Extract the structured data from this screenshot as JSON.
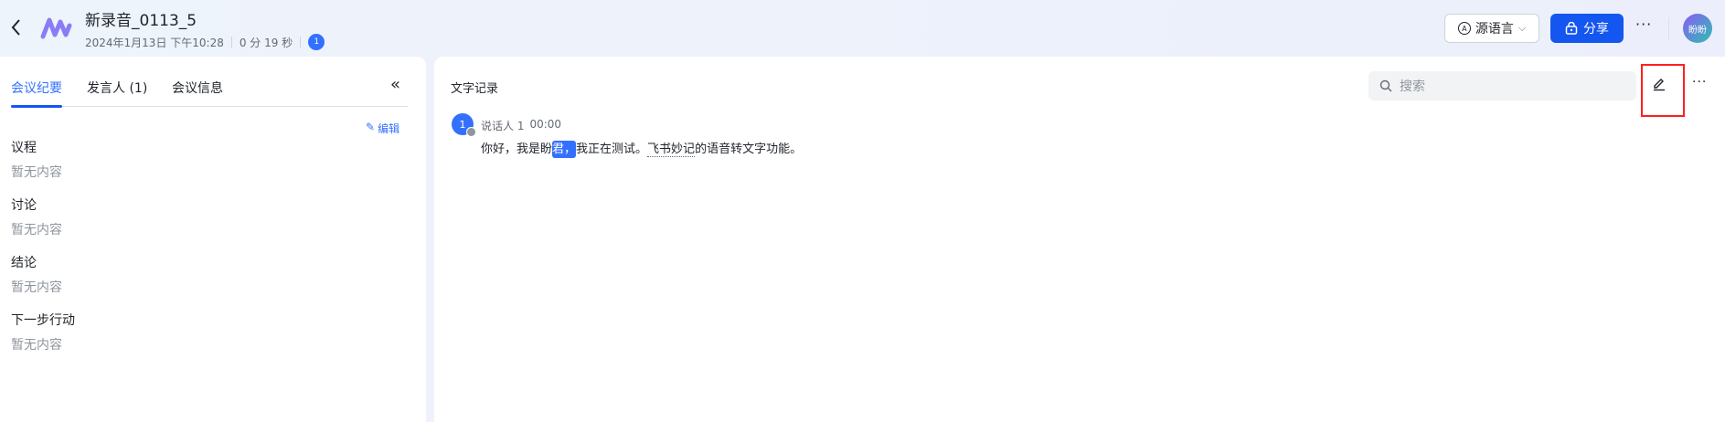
{
  "header": {
    "title": "新录音_0113_5",
    "date": "2024年1月13日 下午10:28",
    "duration": "0 分 19 秒",
    "participant_count": "1",
    "lang_button": "源语言",
    "share_button": "分享",
    "more": "···",
    "user_avatar": "盼盼"
  },
  "left": {
    "tabs": [
      "会议纪要",
      "发言人 (1)",
      "会议信息"
    ],
    "collapse": "«",
    "edit": "编辑",
    "sections": [
      {
        "title": "议程",
        "content": "暂无内容"
      },
      {
        "title": "讨论",
        "content": "暂无内容"
      },
      {
        "title": "结论",
        "content": "暂无内容"
      },
      {
        "title": "下一步行动",
        "content": "暂无内容"
      }
    ]
  },
  "right": {
    "title": "文字记录",
    "search_placeholder": "搜索",
    "more": "···",
    "transcript": [
      {
        "avatar": "1",
        "speaker": "说话人 1",
        "time": "00:00",
        "text_before": "你好，我是盼",
        "text_highlight": "君，",
        "text_mid": "我正在测试。",
        "text_dotted": "飞书妙记",
        "text_after": "的语音转文字功能。"
      }
    ]
  },
  "colors": {
    "accent": "#1456f0",
    "highlight_box": "#ff1f1f"
  }
}
